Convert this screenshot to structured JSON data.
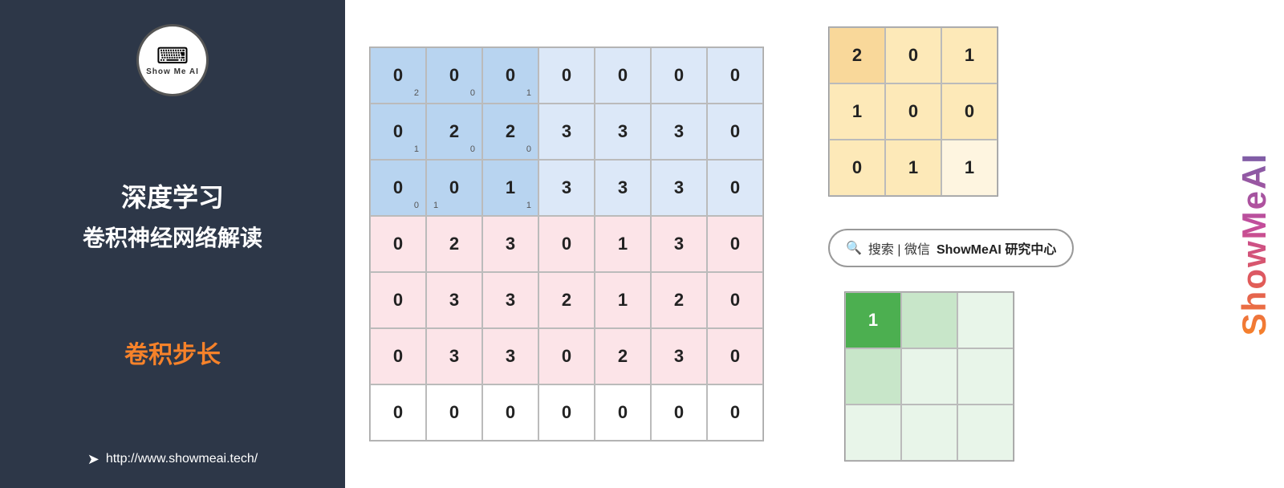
{
  "left": {
    "logo_label": "Show Me AI",
    "logo_icon": "⌨",
    "title_line1": "深度学习",
    "title_line2": "卷积神经网络解读",
    "section_label": "卷积步长",
    "website": "http://www.showmeai.tech/"
  },
  "large_matrix": {
    "rows": [
      [
        {
          "val": "0",
          "sub": "2",
          "pos": "br",
          "bg": "blue"
        },
        {
          "val": "0",
          "sub": "0",
          "pos": "br",
          "bg": "blue"
        },
        {
          "val": "0",
          "sub": "1",
          "pos": "br",
          "bg": "blue"
        },
        {
          "val": "0",
          "sub": "",
          "pos": "",
          "bg": "light"
        },
        {
          "val": "0",
          "sub": "",
          "pos": "",
          "bg": "light"
        },
        {
          "val": "0",
          "sub": "",
          "pos": "",
          "bg": "light"
        },
        {
          "val": "0",
          "sub": "",
          "pos": "",
          "bg": "light"
        }
      ],
      [
        {
          "val": "0",
          "sub": "1",
          "pos": "br",
          "bg": "blue"
        },
        {
          "val": "2",
          "sub": "0",
          "pos": "br",
          "bg": "blue"
        },
        {
          "val": "2",
          "sub": "0",
          "pos": "br",
          "bg": "blue"
        },
        {
          "val": "3",
          "sub": "",
          "pos": "",
          "bg": "light"
        },
        {
          "val": "3",
          "sub": "",
          "pos": "",
          "bg": "light"
        },
        {
          "val": "3",
          "sub": "",
          "pos": "",
          "bg": "light"
        },
        {
          "val": "0",
          "sub": "",
          "pos": "",
          "bg": "light"
        }
      ],
      [
        {
          "val": "0",
          "sub": "0",
          "pos": "br",
          "bg": "blue"
        },
        {
          "val": "0",
          "sub": "1",
          "pos": "bl",
          "bg": "blue"
        },
        {
          "val": "1",
          "sub": "1",
          "pos": "br",
          "bg": "blue"
        },
        {
          "val": "3",
          "sub": "",
          "pos": "",
          "bg": "light"
        },
        {
          "val": "3",
          "sub": "",
          "pos": "",
          "bg": "light"
        },
        {
          "val": "3",
          "sub": "",
          "pos": "",
          "bg": "light"
        },
        {
          "val": "0",
          "sub": "",
          "pos": "",
          "bg": "light"
        }
      ],
      [
        {
          "val": "0",
          "sub": "",
          "pos": "",
          "bg": "pink"
        },
        {
          "val": "2",
          "sub": "",
          "pos": "",
          "bg": "pink"
        },
        {
          "val": "3",
          "sub": "",
          "pos": "",
          "bg": "pink"
        },
        {
          "val": "0",
          "sub": "",
          "pos": "",
          "bg": "pink"
        },
        {
          "val": "1",
          "sub": "",
          "pos": "",
          "bg": "pink"
        },
        {
          "val": "3",
          "sub": "",
          "pos": "",
          "bg": "pink"
        },
        {
          "val": "0",
          "sub": "",
          "pos": "",
          "bg": "pink"
        }
      ],
      [
        {
          "val": "0",
          "sub": "",
          "pos": "",
          "bg": "pink"
        },
        {
          "val": "3",
          "sub": "",
          "pos": "",
          "bg": "pink"
        },
        {
          "val": "3",
          "sub": "",
          "pos": "",
          "bg": "pink"
        },
        {
          "val": "2",
          "sub": "",
          "pos": "",
          "bg": "pink"
        },
        {
          "val": "1",
          "sub": "",
          "pos": "",
          "bg": "pink"
        },
        {
          "val": "2",
          "sub": "",
          "pos": "",
          "bg": "pink"
        },
        {
          "val": "0",
          "sub": "",
          "pos": "",
          "bg": "pink"
        }
      ],
      [
        {
          "val": "0",
          "sub": "",
          "pos": "",
          "bg": "pink"
        },
        {
          "val": "3",
          "sub": "",
          "pos": "",
          "bg": "pink"
        },
        {
          "val": "3",
          "sub": "",
          "pos": "",
          "bg": "pink"
        },
        {
          "val": "0",
          "sub": "",
          "pos": "",
          "bg": "pink"
        },
        {
          "val": "2",
          "sub": "",
          "pos": "",
          "bg": "pink"
        },
        {
          "val": "3",
          "sub": "",
          "pos": "",
          "bg": "pink"
        },
        {
          "val": "0",
          "sub": "",
          "pos": "",
          "bg": "pink"
        }
      ],
      [
        {
          "val": "0",
          "sub": "",
          "pos": "",
          "bg": "white"
        },
        {
          "val": "0",
          "sub": "",
          "pos": "",
          "bg": "white"
        },
        {
          "val": "0",
          "sub": "",
          "pos": "",
          "bg": "white"
        },
        {
          "val": "0",
          "sub": "",
          "pos": "",
          "bg": "white"
        },
        {
          "val": "0",
          "sub": "",
          "pos": "",
          "bg": "white"
        },
        {
          "val": "0",
          "sub": "",
          "pos": "",
          "bg": "white"
        },
        {
          "val": "0",
          "sub": "",
          "pos": "",
          "bg": "white"
        }
      ]
    ]
  },
  "kernel_matrix": {
    "rows": [
      [
        {
          "val": "2",
          "bg": "dark"
        },
        {
          "val": "0",
          "bg": "mid"
        },
        {
          "val": "1",
          "bg": "light"
        }
      ],
      [
        {
          "val": "1",
          "bg": "mid"
        },
        {
          "val": "0",
          "bg": "mid"
        },
        {
          "val": "0",
          "bg": "light"
        }
      ],
      [
        {
          "val": "0",
          "bg": "light"
        },
        {
          "val": "1",
          "bg": "light"
        },
        {
          "val": "1",
          "bg": "vlight"
        }
      ]
    ]
  },
  "output_matrix": {
    "rows": [
      [
        {
          "val": "1",
          "bg": "dark"
        },
        {
          "val": "",
          "bg": "light"
        },
        {
          "val": "",
          "bg": "vlight"
        }
      ],
      [
        {
          "val": "",
          "bg": "light"
        },
        {
          "val": "",
          "bg": "vlight"
        },
        {
          "val": "",
          "bg": "vlight"
        }
      ],
      [
        {
          "val": "",
          "bg": "vlight"
        },
        {
          "val": "",
          "bg": "vlight"
        },
        {
          "val": "",
          "bg": "vlight"
        }
      ]
    ]
  },
  "search": {
    "icon": "🔍",
    "label": "搜索 | 微信",
    "brand": "ShowMeAI 研究中心"
  },
  "vertical_brand": "ShowMeAI"
}
